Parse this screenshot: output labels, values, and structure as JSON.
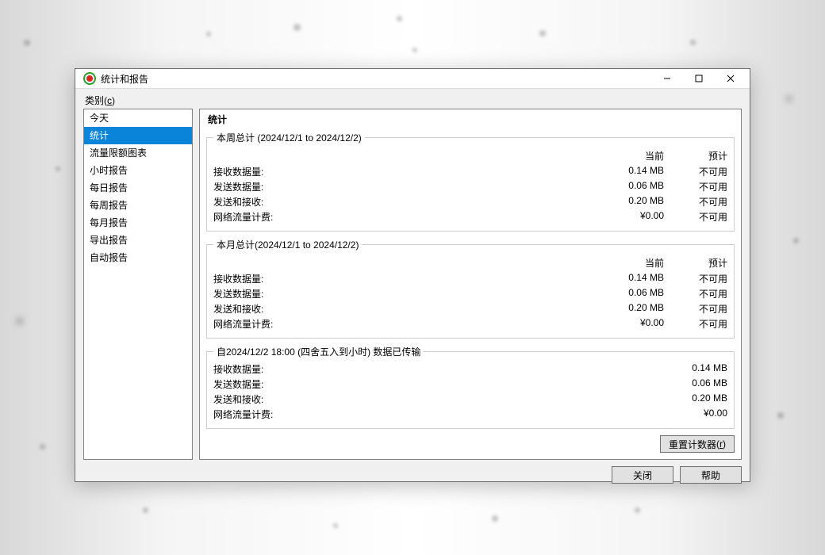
{
  "window": {
    "title": "统计和报告"
  },
  "sidebar": {
    "label_prefix": "类别",
    "label_hotkey": "c",
    "items": [
      "今天",
      "统计",
      "流量限额图表",
      "小时报告",
      "每日报告",
      "每周报告",
      "每月报告",
      "导出报告",
      "自动报告"
    ],
    "selected_index": 1
  },
  "panel_title": "统计",
  "headers": {
    "current": "当前",
    "projected": "预计"
  },
  "rows": {
    "recv": "接收数据量:",
    "send": "发送数据量:",
    "both": "发送和接收:",
    "cost": "网络流量计费:"
  },
  "unavailable": "不可用",
  "weekly": {
    "legend": "本周总计 (2024/12/1 to 2024/12/2)",
    "current": {
      "recv": "0.14 MB",
      "send": "0.06 MB",
      "both": "0.20 MB",
      "cost": "¥0.00"
    },
    "projected": {
      "recv": "不可用",
      "send": "不可用",
      "both": "不可用",
      "cost": "不可用"
    }
  },
  "monthly": {
    "legend": "本月总计(2024/12/1 to 2024/12/2)",
    "current": {
      "recv": "0.14 MB",
      "send": "0.06 MB",
      "both": "0.20 MB",
      "cost": "¥0.00"
    },
    "projected": {
      "recv": "不可用",
      "send": "不可用",
      "both": "不可用",
      "cost": "不可用"
    }
  },
  "since": {
    "legend": "自2024/12/2 18:00 (四舍五入到小时) 数据已传输",
    "recv": "0.14 MB",
    "send": "0.06 MB",
    "both": "0.20 MB",
    "cost": "¥0.00"
  },
  "buttons": {
    "reset_prefix": "重置计数器",
    "reset_hotkey": "r",
    "close": "关闭",
    "help": "帮助"
  }
}
